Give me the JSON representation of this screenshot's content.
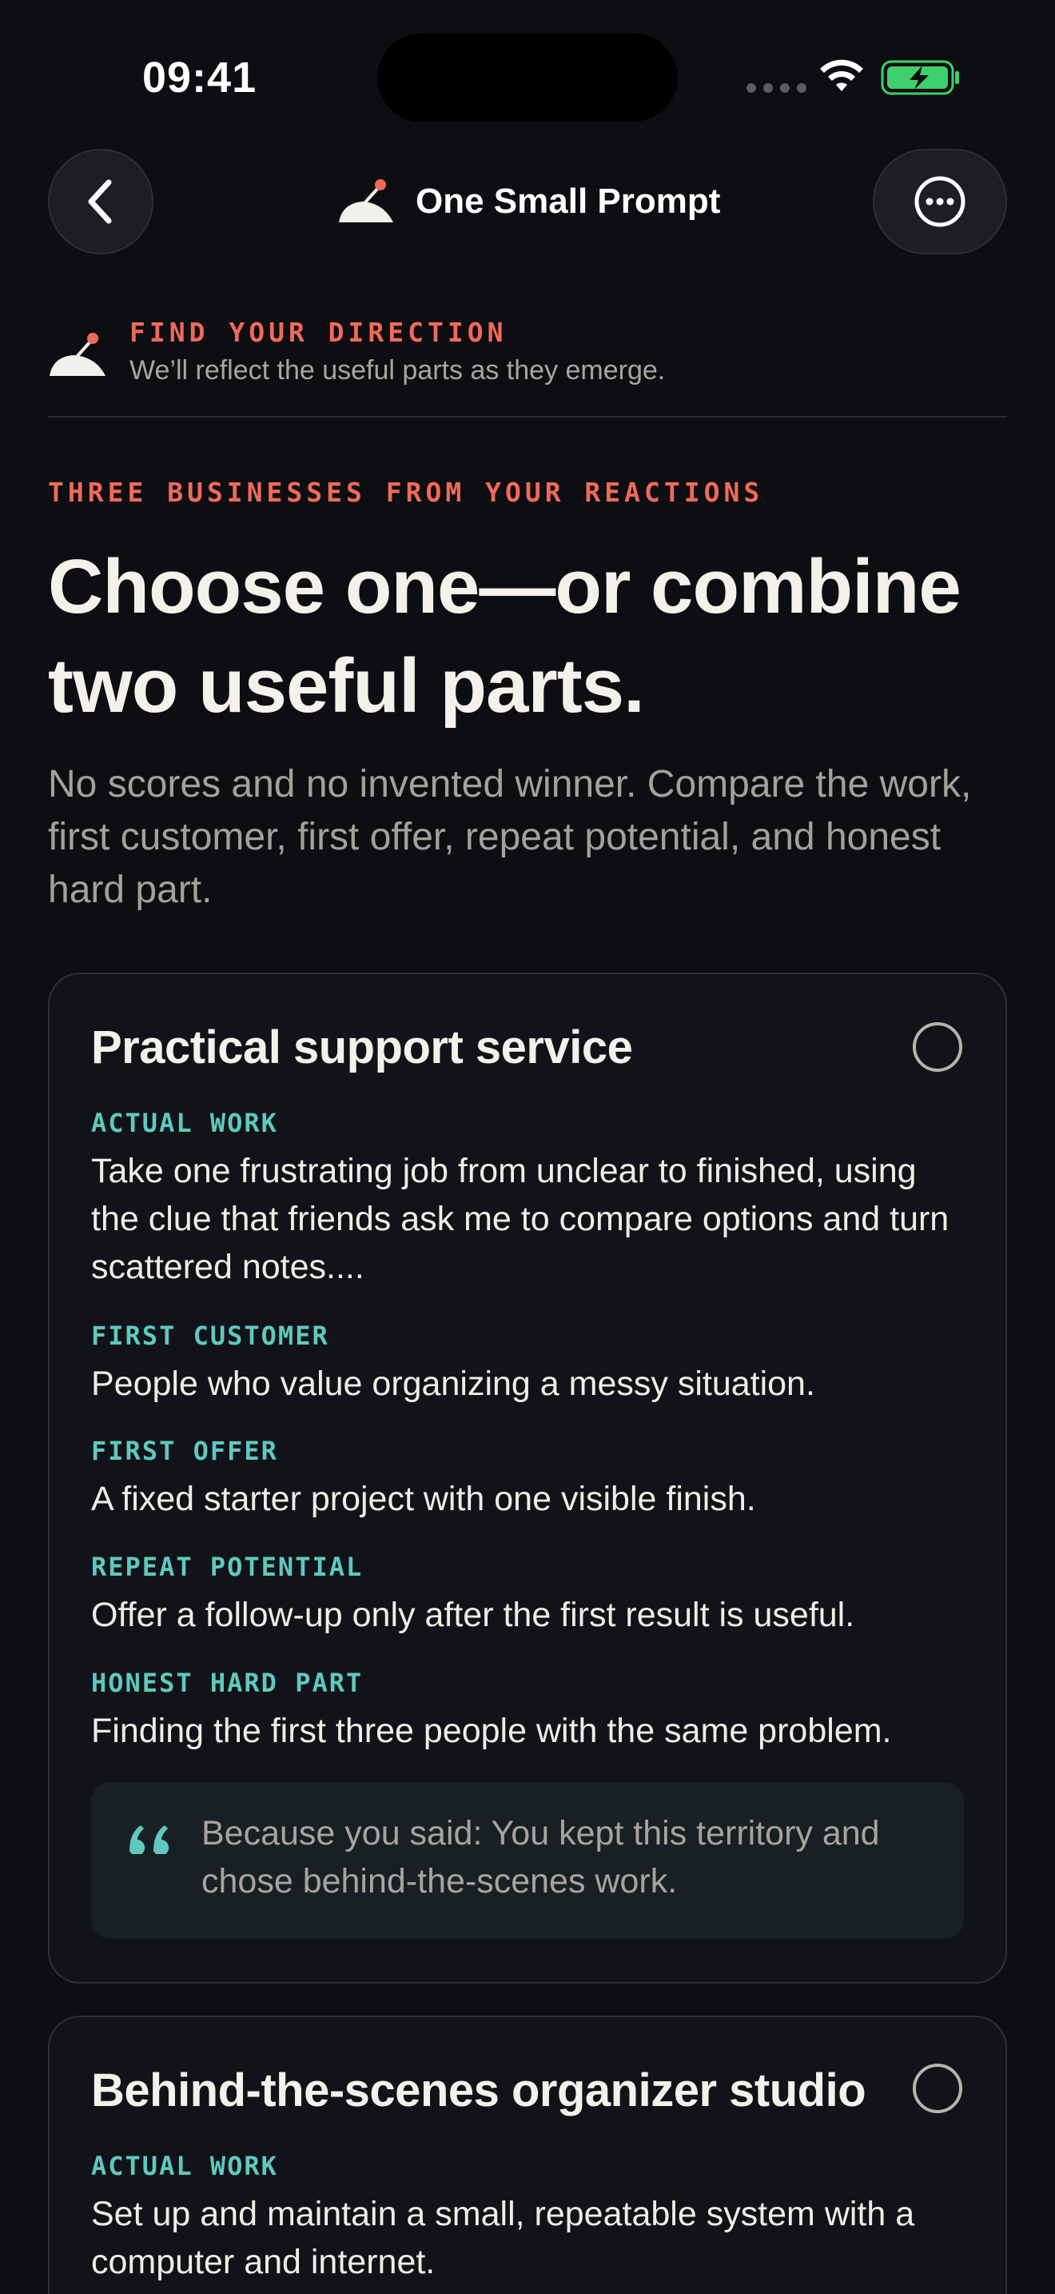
{
  "status_bar": {
    "time": "09:41"
  },
  "header": {
    "title": "One Small Prompt",
    "back_icon": "chevron-left-icon",
    "more_icon": "ellipsis-circle-icon",
    "logo_icon": "desk-bell-icon"
  },
  "direction": {
    "eyebrow": "FIND YOUR DIRECTION",
    "subtitle": "We’ll reflect the useful parts as they emerge."
  },
  "intro": {
    "eyebrow": "THREE BUSINESSES FROM YOUR REACTIONS",
    "heading": "Choose one—or combine two useful parts.",
    "body": "No scores and no invented winner. Compare the work, first customer, first offer, repeat potential, and honest hard part."
  },
  "cards": [
    {
      "title": "Practical support service",
      "fields": [
        {
          "label": "ACTUAL WORK",
          "value": "Take one frustrating job from unclear to finished, using the clue that friends ask me to compare options and turn scattered notes...."
        },
        {
          "label": "FIRST CUSTOMER",
          "value": "People who value organizing a messy situation."
        },
        {
          "label": "FIRST OFFER",
          "value": "A fixed starter project with one visible finish."
        },
        {
          "label": "REPEAT POTENTIAL",
          "value": "Offer a follow-up only after the first result is useful."
        },
        {
          "label": "HONEST HARD PART",
          "value": "Finding the first three people with the same problem."
        }
      ],
      "quote": "Because you said: You kept this territory and chose behind-the-scenes work."
    },
    {
      "title": "Behind-the-scenes organizer studio",
      "fields": [
        {
          "label": "ACTUAL WORK",
          "value": "Set up and maintain a small, repeatable system with a computer and internet."
        }
      ]
    }
  ],
  "colors": {
    "background": "#0d0e12",
    "accent_coral": "#f06a5a",
    "accent_teal": "#5fc9bd",
    "card_bg": "#111318",
    "battery_green": "#3fd06b"
  }
}
